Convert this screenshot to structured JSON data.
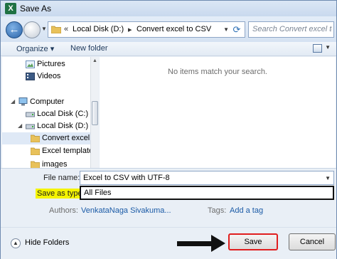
{
  "window": {
    "title": "Save As",
    "app_icon_text": "X"
  },
  "address_bar": {
    "chevron": "«",
    "segments": [
      "Local Disk (D:)",
      "Convert excel to CSV"
    ],
    "separator": "▸"
  },
  "search": {
    "placeholder": "Search Convert excel to CSV"
  },
  "toolbar": {
    "organize_label": "Organize ▾",
    "new_folder_label": "New folder"
  },
  "nav_pane": {
    "items": [
      {
        "label": "Pictures",
        "icon": "pictures-icon",
        "indent": 2
      },
      {
        "label": "Videos",
        "icon": "videos-icon",
        "indent": 2
      },
      {
        "label": "Computer",
        "icon": "computer-icon",
        "indent": 1
      },
      {
        "label": "Local Disk (C:)",
        "icon": "drive-icon",
        "indent": 2
      },
      {
        "label": "Local Disk (D:)",
        "icon": "drive-icon",
        "indent": 2
      },
      {
        "label": "Convert excel t",
        "icon": "folder-icon",
        "indent": 3,
        "selected": true
      },
      {
        "label": "Excel template",
        "icon": "folder-icon",
        "indent": 3
      },
      {
        "label": "images",
        "icon": "folder-icon",
        "indent": 3
      }
    ]
  },
  "file_area": {
    "empty_message": "No items match your search."
  },
  "form": {
    "file_name_label": "File name:",
    "file_name_value": "Excel to CSV with UTF-8",
    "save_as_type_label": "Save as type:",
    "save_as_type_value": "All Files",
    "authors_label": "Authors:",
    "authors_value": "VenkataNaga Sivakuma...",
    "tags_label": "Tags:",
    "tags_value": "Add a tag"
  },
  "footer": {
    "hide_folders_label": "Hide Folders",
    "save_label": "Save",
    "cancel_label": "Cancel"
  },
  "colors": {
    "highlight": "#f4f400",
    "save_border": "#e01e1e",
    "annotation_arrow": "#111111",
    "link": "#1a5aa6"
  }
}
